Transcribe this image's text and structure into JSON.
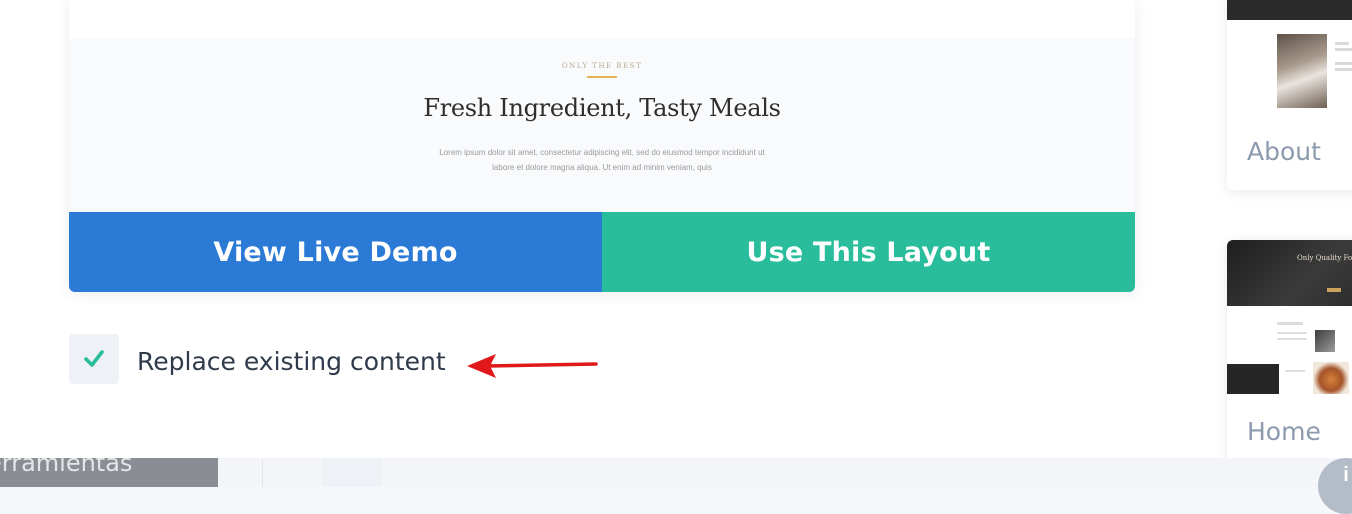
{
  "preview": {
    "eyebrow": "ONLY THE BEST",
    "heading": "Fresh Ingredient, Tasty Meals",
    "body": "Lorem ipsum dolor sit amet, consectetur adipiscing elit, sed do eiusmod tempor incididunt ut labore et dolore magna aliqua. Ut enim ad minim veniam, quis"
  },
  "buttons": {
    "view_demo_label": "View Live Demo",
    "use_layout_label": "Use This Layout"
  },
  "replace_option": {
    "label": "Replace existing content",
    "checked": true,
    "check_icon": "check-icon"
  },
  "layouts": [
    {
      "label": "About"
    },
    {
      "label": "Home",
      "hero_text": "Only Quality Fo"
    }
  ],
  "taskbar": {
    "left_text": "erramientas",
    "fab_text": "i"
  },
  "colors": {
    "view_demo_bg": "#2b7bd6",
    "use_layout_bg": "#29bd9c",
    "checkmark": "#29bd9c",
    "arrow": "#e0181a",
    "label_text": "#2f3a4a",
    "side_label_text": "#8c9aae"
  }
}
